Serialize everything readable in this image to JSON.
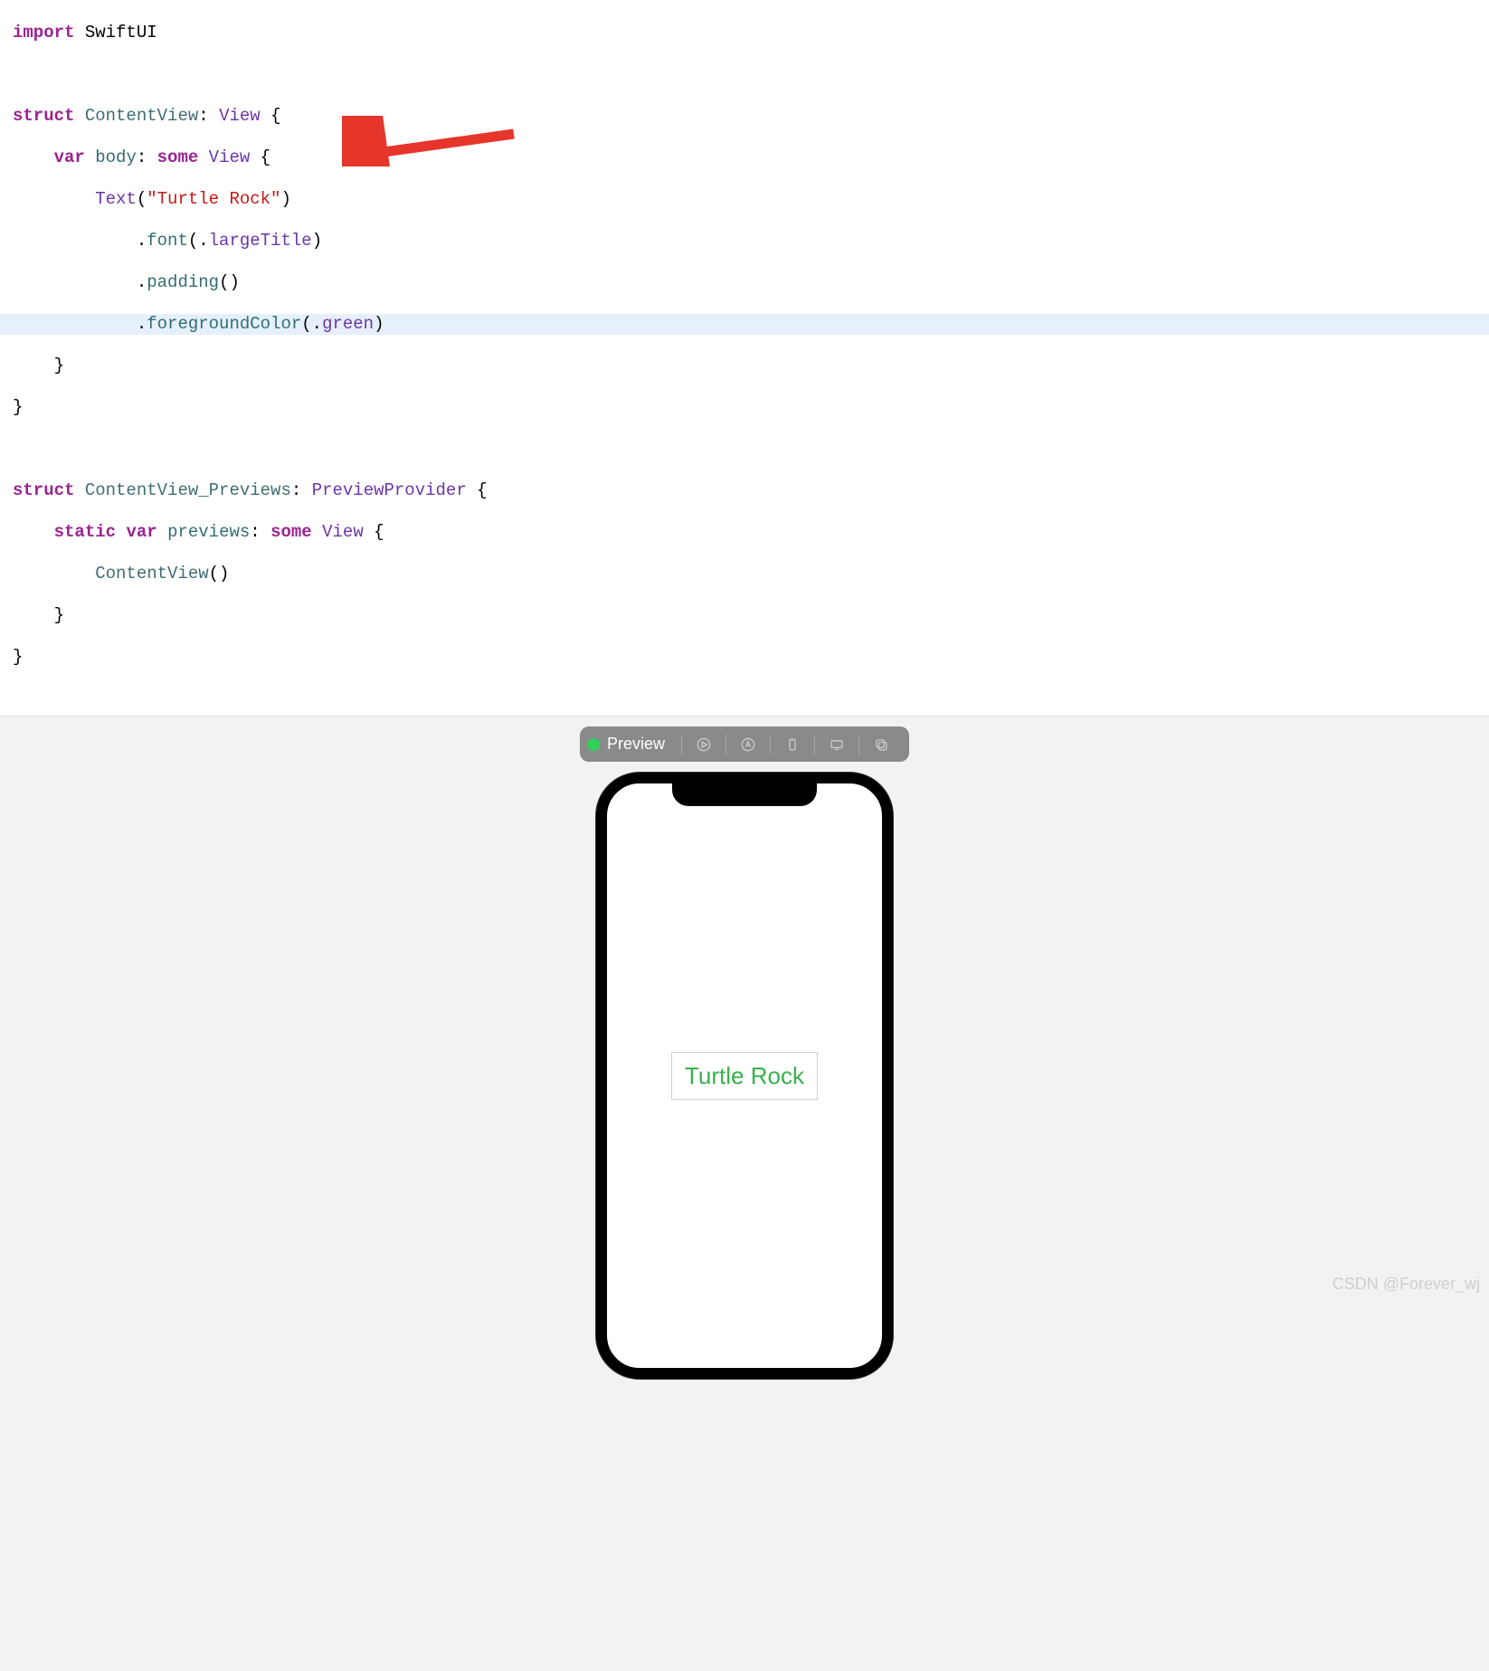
{
  "code": {
    "import_kw": "import",
    "swiftui": "SwiftUI",
    "struct_kw": "struct",
    "contentview": "ContentView",
    "view": "View",
    "var_kw": "var",
    "body": "body",
    "some_kw": "some",
    "text_type": "Text",
    "turtle_string": "\"Turtle Rock\"",
    "font_mod": "font",
    "largeTitle": "largeTitle",
    "padding_mod": "padding",
    "foregroundColor_mod": "foregroundColor",
    "green": "green",
    "previews_struct": "ContentView_Previews",
    "previewprovider": "PreviewProvider",
    "static_kw": "static",
    "previews_prop": "previews",
    "contentview_call": "ContentView"
  },
  "toolbar": {
    "label": "Preview"
  },
  "preview": {
    "text": "Turtle Rock"
  },
  "watermark": "CSDN @Forever_wj"
}
